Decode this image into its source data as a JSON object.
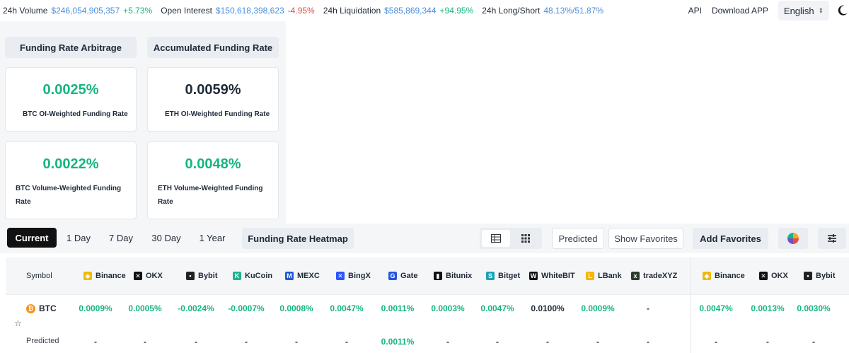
{
  "topbar": {
    "stats": [
      {
        "label": "24h Volume",
        "value": "$246,054,905,357",
        "change": "+5.73%",
        "dir": "pos"
      },
      {
        "label": "Open Interest",
        "value": "$150,618,398,623",
        "change": "-4.95%",
        "dir": "neg"
      },
      {
        "label": "24h Liquidation",
        "value": "$585,869,344",
        "change": "+94.95%",
        "dir": "pos"
      },
      {
        "label": "24h Long/Short",
        "value": "48.13%/51.87%",
        "change": "",
        "dir": "pos"
      }
    ],
    "api": "API",
    "download": "Download APP",
    "language": "English"
  },
  "panel": {
    "tab_arbitrage": "Funding Rate Arbitrage",
    "tab_accumulated": "Accumulated Funding Rate",
    "cards": [
      {
        "value": "0.0025%",
        "label": "BTC OI-Weighted Funding Rate",
        "color": "green"
      },
      {
        "value": "0.0059%",
        "label": "ETH OI-Weighted Funding Rate",
        "color": "dark"
      },
      {
        "value": "0.0022%",
        "label_line1": "BTC Volume-Weighted Funding",
        "label_line2": "Rate",
        "color": "green"
      },
      {
        "value": "0.0048%",
        "label_line1": "ETH Volume-Weighted Funding",
        "label_line2": "Rate",
        "color": "green"
      }
    ]
  },
  "toolbar": {
    "periods": [
      "Current",
      "1 Day",
      "7 Day",
      "30 Day",
      "1 Year"
    ],
    "active_period": "Current",
    "heatmap": "Funding Rate Heatmap",
    "predicted": "Predicted",
    "show_favorites": "Show Favorites",
    "add_favorites": "Add Favorites"
  },
  "table": {
    "symbol_header": "Symbol",
    "exchanges": [
      {
        "name": "Binance",
        "icon": "binance-icon",
        "color": "#f0b90b"
      },
      {
        "name": "OKX",
        "icon": "okx-icon",
        "color": "#111111"
      },
      {
        "name": "Bybit",
        "icon": "bybit-icon",
        "color": "#222222"
      },
      {
        "name": "KuCoin",
        "icon": "kucoin-icon",
        "color": "#23af91"
      },
      {
        "name": "MEXC",
        "icon": "mexc-icon",
        "color": "#1f5bd6"
      },
      {
        "name": "BingX",
        "icon": "bingx-icon",
        "color": "#2a54ff"
      },
      {
        "name": "Gate",
        "icon": "gate-icon",
        "color": "#2354e6"
      },
      {
        "name": "Bitunix",
        "icon": "bitunix-icon",
        "color": "#111111"
      },
      {
        "name": "Bitget",
        "icon": "bitget-icon",
        "color": "#1da2b4"
      },
      {
        "name": "WhiteBIT",
        "icon": "whitebit-icon",
        "color": "#111111"
      },
      {
        "name": "LBank",
        "icon": "lbank-icon",
        "color": "#f7b500"
      },
      {
        "name": "tradeXYZ",
        "icon": "tradexyz-icon",
        "color": "#2d3a2e"
      },
      {
        "name": "Binance",
        "icon": "binance-icon",
        "color": "#f0b90b"
      },
      {
        "name": "OKX",
        "icon": "okx-icon",
        "color": "#111111"
      },
      {
        "name": "Bybit",
        "icon": "bybit-icon",
        "color": "#222222"
      }
    ],
    "rows": [
      {
        "symbol": "BTC",
        "values": [
          "0.0009%",
          "0.0005%",
          "-0.0024%",
          "-0.0007%",
          "0.0008%",
          "0.0047%",
          "0.0011%",
          "0.0003%",
          "0.0047%",
          "0.0100%",
          "0.0009%",
          "-",
          "0.0047%",
          "0.0013%",
          "0.0030%"
        ],
        "colors": [
          "g",
          "g",
          "g",
          "g",
          "g",
          "g",
          "g",
          "g",
          "g",
          "k",
          "g",
          "k",
          "g",
          "g",
          "g"
        ]
      }
    ],
    "predicted_label": "Predicted",
    "predicted_values": [
      "-",
      "-",
      "-",
      "-",
      "-",
      "-",
      "0.0011%",
      "-",
      "-",
      "-",
      "-",
      "-",
      "-",
      "-",
      "-"
    ]
  }
}
